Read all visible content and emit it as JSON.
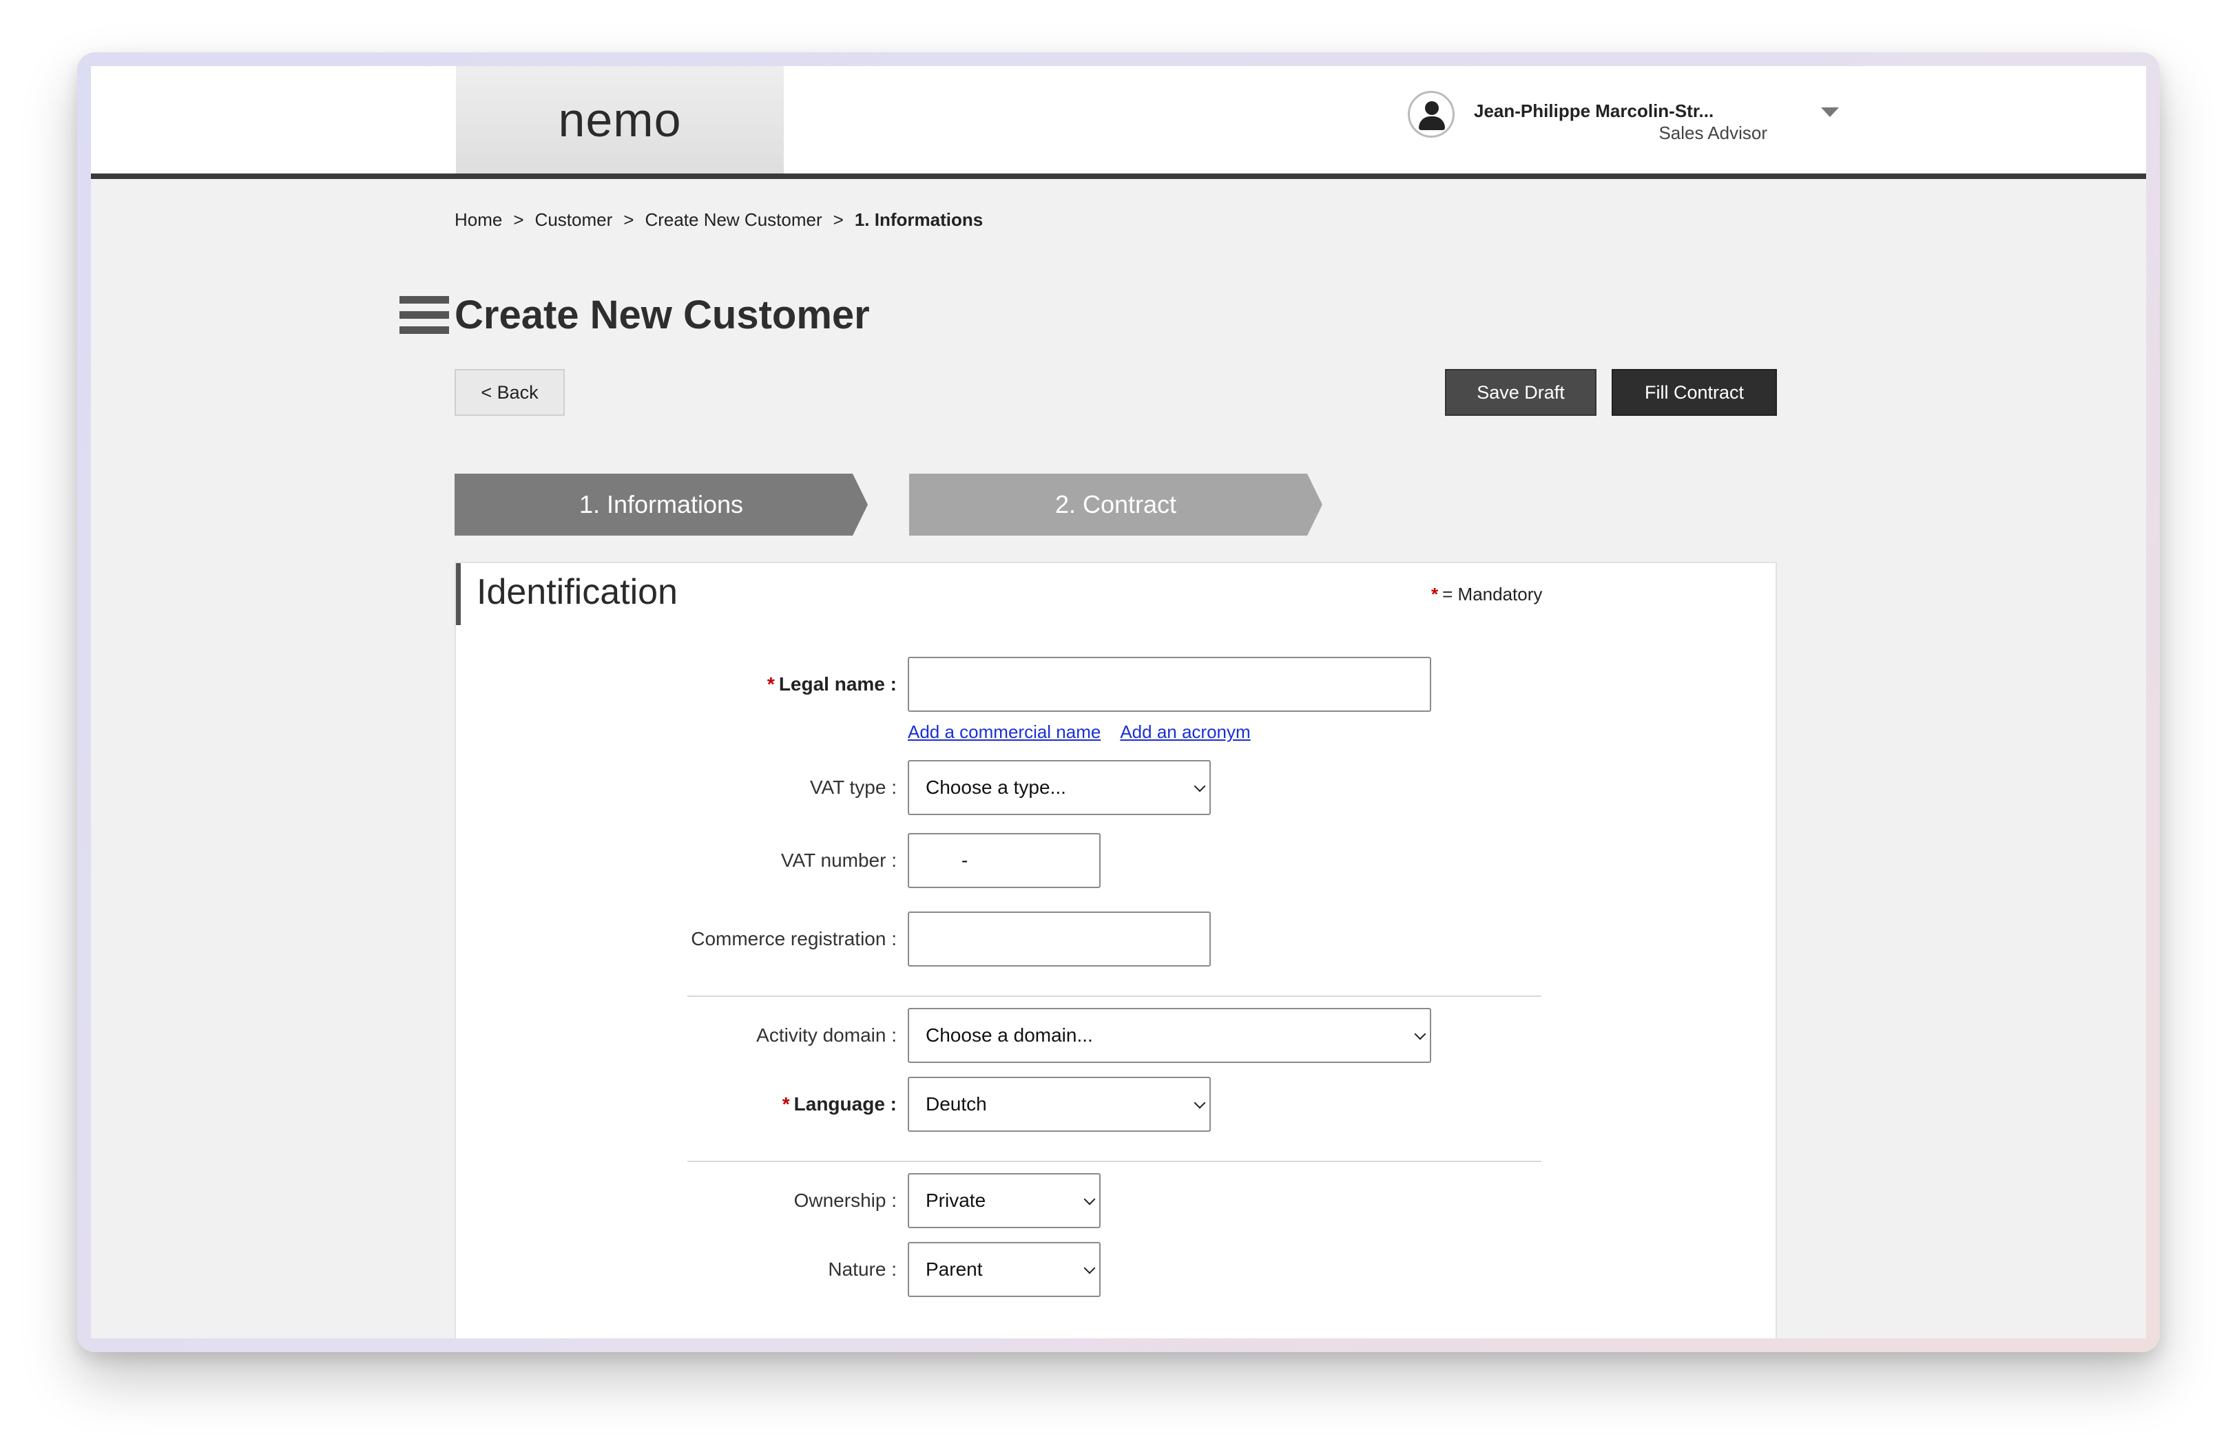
{
  "app": {
    "logo": "nemo"
  },
  "user": {
    "name": "Jean-Philippe Marcolin-Str...",
    "role": "Sales Advisor"
  },
  "breadcrumb": {
    "items": [
      "Home",
      "Customer",
      "Create New Customer",
      "1. Informations"
    ],
    "separator": ">"
  },
  "page": {
    "title": "Create New Customer"
  },
  "buttons": {
    "back": "< Back",
    "save_draft": "Save Draft",
    "fill_contract": "Fill Contract"
  },
  "steps": [
    {
      "label": "1. Informations",
      "active": true
    },
    {
      "label": "2. Contract",
      "active": false
    }
  ],
  "section": {
    "title": "Identification",
    "mandatory_mark": "*",
    "mandatory_note": "= Mandatory"
  },
  "form": {
    "required_mark": "*",
    "legal_name": {
      "label": "Legal name :",
      "value": ""
    },
    "links": {
      "commercial_name": "Add a commercial name",
      "acronym": "Add an acronym"
    },
    "vat_type": {
      "label": "VAT type :",
      "value": "Choose a type..."
    },
    "vat_number": {
      "label": "VAT number :",
      "value": "-"
    },
    "commerce_registration": {
      "label": "Commerce registration :",
      "value": ""
    },
    "activity_domain": {
      "label": "Activity domain :",
      "value": "Choose a domain..."
    },
    "language": {
      "label": "Language :",
      "value": "Deutch"
    },
    "ownership": {
      "label": "Ownership :",
      "value": "Private"
    },
    "nature": {
      "label": "Nature :",
      "value": "Parent"
    }
  },
  "colors": {
    "header_border": "#3a3a3a",
    "step_active": "#7b7b7b",
    "step_inactive": "#a6a6a6",
    "required": "#c40000",
    "link": "#1a2fd6",
    "primary_button": "#2e2e2e"
  }
}
